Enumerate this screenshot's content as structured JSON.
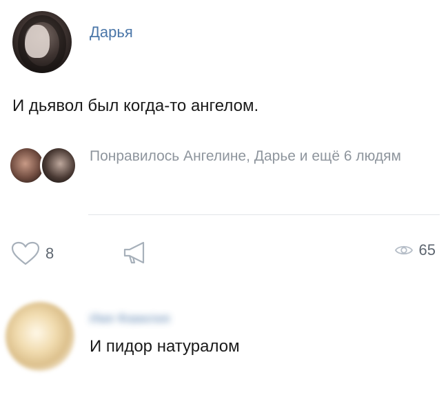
{
  "post": {
    "author": "Дарья",
    "text": "И дьявол был когда-то ангелом.",
    "likes_summary": "Понравилось Ангелине, Дарье и ещё 6 людям"
  },
  "actions": {
    "like_count": "8",
    "views_count": "65",
    "like_icon": "heart-icon",
    "share_icon": "megaphone-icon",
    "views_icon": "eye-icon"
  },
  "comment": {
    "author": "Имя Фамилия",
    "text": "И пидор натуралом"
  },
  "colors": {
    "link": "#4a76a8",
    "muted": "#8e959d",
    "icon": "#a7b0ba"
  }
}
